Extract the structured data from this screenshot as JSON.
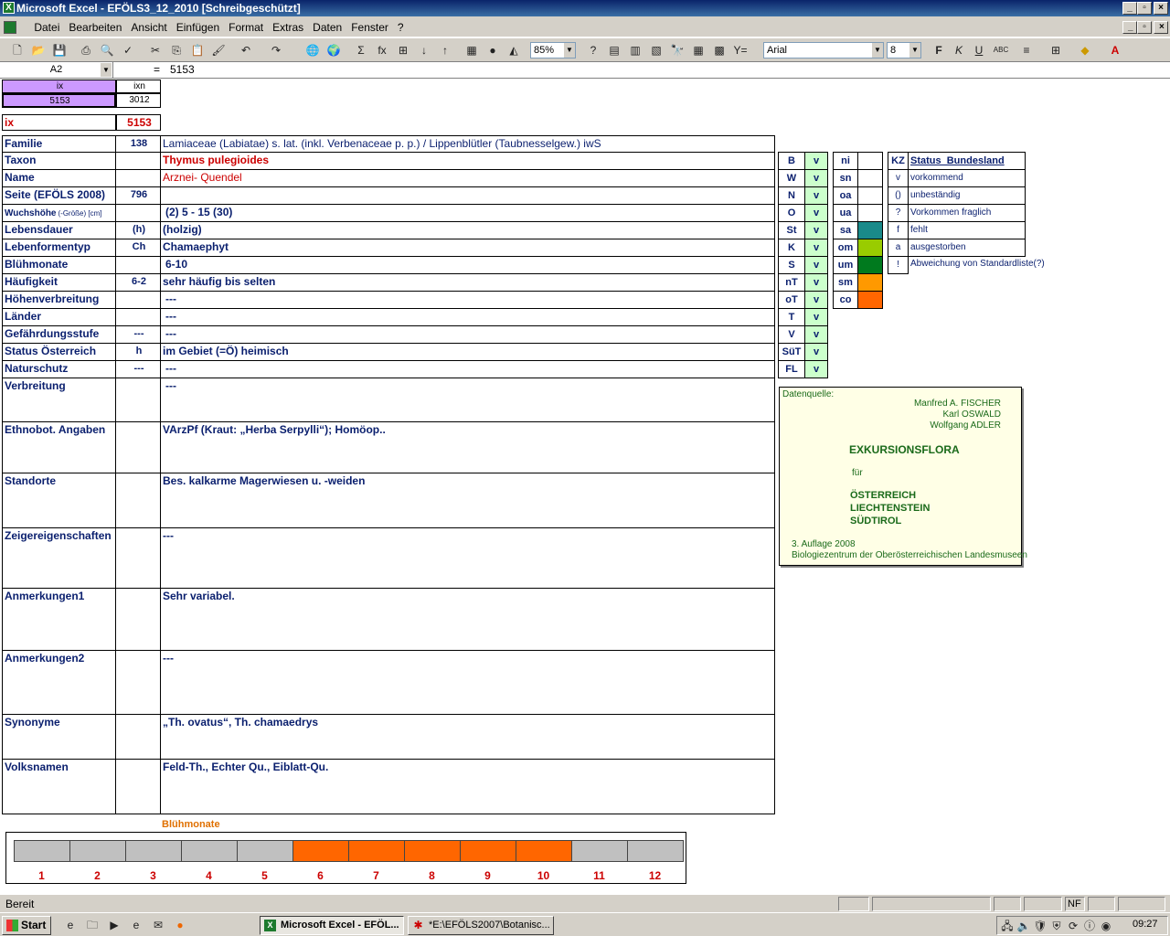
{
  "window": {
    "title": "Microsoft Excel - EFÖLS3_12_2010  [Schreibgeschützt]"
  },
  "menu": [
    "Datei",
    "Bearbeiten",
    "Ansicht",
    "Einfügen",
    "Format",
    "Extras",
    "Daten",
    "Fenster",
    "?"
  ],
  "toolbar": {
    "zoom": "85%",
    "font": "Arial",
    "size": "8"
  },
  "formula": {
    "namebox": "A2",
    "eq": "=",
    "value": "5153"
  },
  "header": {
    "ix_label": "ix",
    "ixn_label": "ixn",
    "ix_value": "5153",
    "ixn_value": "3012",
    "ix_big_label": "ix",
    "ix_big_value": "5153"
  },
  "rows": [
    {
      "label": "Familie",
      "code": "138",
      "value": "Lamiaceae (Labiatae) s. lat. (inkl. Verbenaceae p. p.)  /  Lippenblütler (Taubnesselgew.) iwS"
    },
    {
      "label": "Taxon",
      "code": "",
      "value": "Thymus pulegioides"
    },
    {
      "label": "Name",
      "code": "",
      "value": "Arznei- Quendel"
    },
    {
      "label": "Seite (EFÖLS 2008)",
      "code": "796",
      "value": ""
    },
    {
      "label": "Wuchshöhe",
      "label_small": "(-Größe) [cm]",
      "code": "",
      "value": "(2) 5 - 15 (30)"
    },
    {
      "label": "Lebensdauer",
      "code": "(h)",
      "value": "(holzig)"
    },
    {
      "label": "Lebenformentyp",
      "code": "Ch",
      "value": "Chamaephyt"
    },
    {
      "label": "Blühmonate",
      "code": "",
      "value": "6-10"
    },
    {
      "label": "Häufigkeit",
      "code": "6-2",
      "value": "sehr häufig bis selten"
    },
    {
      "label": "Höhenverbreitung",
      "code": "",
      "value": "---"
    },
    {
      "label": "Länder",
      "code": "",
      "value": "---"
    },
    {
      "label": "Gefährdungsstufe",
      "code": "---",
      "value": "---"
    },
    {
      "label": "Status Österreich",
      "code": "h",
      "value": "im Gebiet (=Ö) heimisch"
    },
    {
      "label": "Naturschutz",
      "code": "---",
      "value": "---"
    },
    {
      "label": "Verbreitung",
      "code": "",
      "value": "---"
    },
    {
      "label": "Ethnobot. Angaben",
      "code": "",
      "value": "VArzPf (Kraut: „Herba Serpylli“); Homöop.."
    },
    {
      "label": "Standorte",
      "code": "",
      "value": "Bes. kalkarme Magerwiesen u. -weiden"
    },
    {
      "label": "Zeigereigenschaften",
      "code": "",
      "value": "---"
    },
    {
      "label": "Anmerkungen1",
      "code": "",
      "value": "Sehr variabel."
    },
    {
      "label": "Anmerkungen2",
      "code": "",
      "value": "---"
    },
    {
      "label": "Synonyme",
      "code": "",
      "value": "„Th. ovatus“, Th. chamaedrys"
    },
    {
      "label": "Volksnamen",
      "code": "",
      "value": "Feld-Th., Echter Qu., Eiblatt-Qu."
    }
  ],
  "regions": [
    {
      "code": "B",
      "v": "v"
    },
    {
      "code": "W",
      "v": "v"
    },
    {
      "code": "N",
      "v": "v"
    },
    {
      "code": "O",
      "v": "v"
    },
    {
      "code": "St",
      "v": "v"
    },
    {
      "code": "K",
      "v": "v"
    },
    {
      "code": "S",
      "v": "v"
    },
    {
      "code": "nT",
      "v": "v"
    },
    {
      "code": "oT",
      "v": "v"
    },
    {
      "code": "T",
      "v": "v"
    },
    {
      "code": "V",
      "v": "v"
    },
    {
      "code": "SüT",
      "v": "v"
    },
    {
      "code": "FL",
      "v": "v"
    }
  ],
  "zones": [
    {
      "code": "ni",
      "color": "#ffffff"
    },
    {
      "code": "sn",
      "color": "#ffffff"
    },
    {
      "code": "oa",
      "color": "#ffffff"
    },
    {
      "code": "ua",
      "color": "#ffffff"
    },
    {
      "code": "sa",
      "color": "#1a8a8a"
    },
    {
      "code": "om",
      "color": "#99cc00"
    },
    {
      "code": "um",
      "color": "#007a1e"
    },
    {
      "code": "sm",
      "color": "#ff9900"
    },
    {
      "code": "co",
      "color": "#ff6600"
    }
  ],
  "status_legend": {
    "header_kz": "KZ",
    "header_title": "Status_Bundesland",
    "items": [
      {
        "kz": "v",
        "text": "vorkommend"
      },
      {
        "kz": "()",
        "text": "unbeständig"
      },
      {
        "kz": "?",
        "text": "Vorkommen fraglich"
      },
      {
        "kz": "f",
        "text": "fehlt"
      },
      {
        "kz": "a",
        "text": "ausgestorben"
      },
      {
        "kz": "!",
        "text": "Abweichung von Standardliste(?)"
      }
    ]
  },
  "source": {
    "label": "Datenquelle:",
    "authors": [
      "Manfred A. FISCHER",
      "Karl OSWALD",
      "Wolfgang ADLER"
    ],
    "title": "EXKURSIONSFLORA",
    "fuer": "für",
    "countries": [
      "ÖSTERREICH",
      "LIECHTENSTEIN",
      "SÜDTIROL"
    ],
    "edition": "3. Auflage 2008",
    "publisher": "Biologiezentrum der Oberösterreichischen Landesmuseen"
  },
  "chart_data": {
    "type": "bar",
    "title": "Blühmonate",
    "categories": [
      "1",
      "2",
      "3",
      "4",
      "5",
      "6",
      "7",
      "8",
      "9",
      "10",
      "11",
      "12"
    ],
    "values": [
      0,
      0,
      0,
      0,
      0,
      1,
      1,
      1,
      1,
      1,
      0,
      0
    ],
    "colors": {
      "on": "#ff6600",
      "off": "#c0c0c0"
    }
  },
  "statusbar": {
    "text": "Bereit",
    "nf": "NF"
  },
  "taskbar": {
    "start": "Start",
    "tasks": [
      "Microsoft Excel - EFÖL...",
      "*E:\\EFÖLS2007\\Botanisc..."
    ],
    "clock": "09:27"
  }
}
